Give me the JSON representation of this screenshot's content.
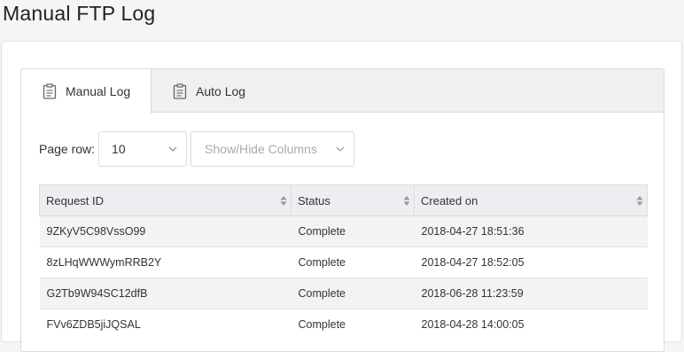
{
  "page": {
    "title": "Manual FTP Log"
  },
  "tabs": [
    {
      "label": "Manual Log",
      "icon": "clipboard-icon",
      "active": true
    },
    {
      "label": "Auto Log",
      "icon": "clipboard-icon",
      "active": false
    }
  ],
  "controls": {
    "page_row_label": "Page row:",
    "page_row_value": "10",
    "columns_placeholder": "Show/Hide Columns"
  },
  "table": {
    "headers": [
      "Request ID",
      "Status",
      "Created on"
    ],
    "rows": [
      {
        "id": "9ZKyV5C98VssO99",
        "status": "Complete",
        "created": "2018-04-27 18:51:36"
      },
      {
        "id": "8zLHqWWWymRRB2Y",
        "status": "Complete",
        "created": "2018-04-27 18:52:05"
      },
      {
        "id": "G2Tb9W94SC12dfB",
        "status": "Complete",
        "created": "2018-06-28 11:23:59"
      },
      {
        "id": "FVv6ZDB5jiJQSAL",
        "status": "Complete",
        "created": "2018-04-28 14:00:05"
      }
    ]
  }
}
